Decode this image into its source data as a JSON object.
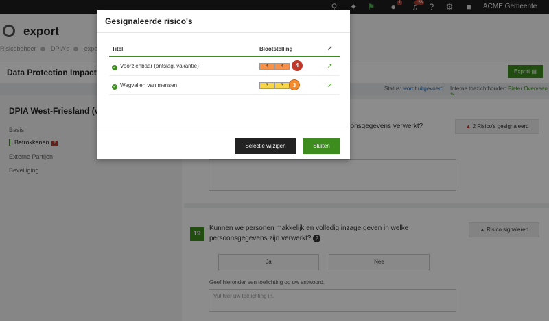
{
  "topbar": {
    "notif_count": "1",
    "alert_count": "153",
    "org_name": "ACME Gemeente",
    "icons": [
      "search-icon",
      "pin-icon",
      "flag-icon",
      "users-icon",
      "bell-icon",
      "help-icon",
      "gear-icon",
      "user-icon"
    ]
  },
  "app": {
    "title": "export",
    "breadcrumbs": [
      "Risicobeheer",
      "DPIA's",
      "export"
    ]
  },
  "doc": {
    "title": "Data Protection Impact A",
    "export_label": "Export",
    "status_label": "Status:",
    "status_value": "wordt uitgevoerd",
    "supervisor_label": "Interne toezichthouder:",
    "supervisor_value": "Pieter Overveen"
  },
  "sidebar": {
    "project": "DPIA West-Friesland (v17",
    "items": [
      {
        "label": "Basis"
      },
      {
        "label": "Betrokkenen",
        "count": "2"
      },
      {
        "label": "Externe Partijen"
      },
      {
        "label": "Beveiliging"
      }
    ]
  },
  "questions": {
    "q18_fragment": "oonsgegevens verwerkt?",
    "q18_risk_label": "2 Risico's gesignaleerd",
    "q19_number": "19",
    "q19_text": "Kunnen we personen makkelijk en volledig inzage geven in welke persoonsgegevens zijn verwerkt?",
    "q19_risk_label": "Risico signaleren",
    "answer_yes": "Ja",
    "answer_no": "Nee",
    "hint": "Geef hieronder een toelichting op uw antwoord.",
    "placeholder": "Vul hier uw toelichting in."
  },
  "modal": {
    "title": "Gesignaleerde risico's",
    "col_title": "Titel",
    "col_exposure": "Blootstelling",
    "rows": [
      {
        "title": "Voorzienbaar (ontslag, vakantie)",
        "a": "4",
        "b": "4",
        "score": "4",
        "color": "#f4924a",
        "score_color": "#c0392b"
      },
      {
        "title": "Wegvallen van mensen",
        "a": "3",
        "b": "3",
        "score": "3",
        "color": "#f7d54a",
        "score_color": "#f08c2e"
      }
    ],
    "change_label": "Selectie wijzigen",
    "close_label": "Sluiten"
  }
}
